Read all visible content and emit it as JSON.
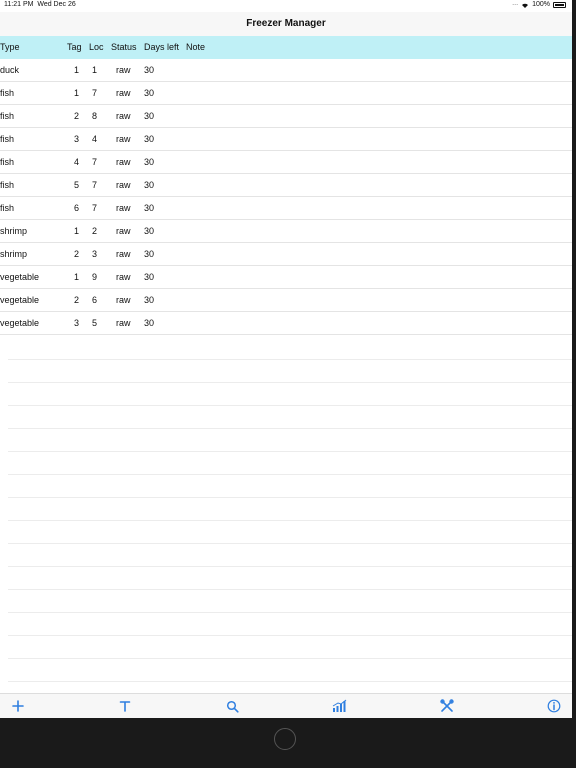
{
  "status_bar": {
    "time": "11:21 PM",
    "date": "Wed Dec 26",
    "battery": "100%"
  },
  "nav": {
    "title": "Freezer Manager"
  },
  "table": {
    "headers": [
      "Type",
      "Tag",
      "Loc",
      "Status",
      "Days left",
      "Note"
    ],
    "rows": [
      [
        "duck",
        "1",
        "1",
        "raw",
        "30",
        ""
      ],
      [
        "fish",
        "1",
        "7",
        "raw",
        "30",
        ""
      ],
      [
        "fish",
        "2",
        "8",
        "raw",
        "30",
        ""
      ],
      [
        "fish",
        "3",
        "4",
        "raw",
        "30",
        ""
      ],
      [
        "fish",
        "4",
        "7",
        "raw",
        "30",
        ""
      ],
      [
        "fish",
        "5",
        "7",
        "raw",
        "30",
        ""
      ],
      [
        "fish",
        "6",
        "7",
        "raw",
        "30",
        ""
      ],
      [
        "shrimp",
        "1",
        "2",
        "raw",
        "30",
        ""
      ],
      [
        "shrimp",
        "2",
        "3",
        "raw",
        "30",
        ""
      ],
      [
        "vegetable",
        "1",
        "9",
        "raw",
        "30",
        ""
      ],
      [
        "vegetable",
        "2",
        "6",
        "raw",
        "30",
        ""
      ],
      [
        "vegetable",
        "3",
        "5",
        "raw",
        "30",
        ""
      ]
    ]
  },
  "tab_bar": {
    "accent": "#2f7fe0",
    "icons": [
      "plus-icon",
      "text-icon",
      "search-icon",
      "chart-icon",
      "tools-icon",
      "info-icon"
    ]
  }
}
